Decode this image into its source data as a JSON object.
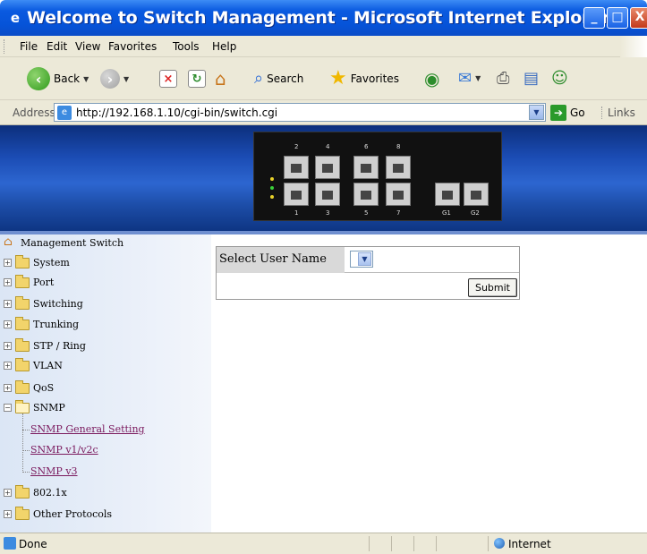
{
  "window": {
    "title": "Welcome to Switch Management - Microsoft Internet Explorer",
    "minimize": "_",
    "maximize": "□",
    "close": "X"
  },
  "menu": [
    "File",
    "Edit",
    "View",
    "Favorites",
    "Tools",
    "Help"
  ],
  "toolbar": {
    "back": "Back",
    "search": "Search",
    "favorites": "Favorites"
  },
  "address": {
    "label": "Address",
    "url": "http://192.168.1.10/cgi-bin/switch.cgi",
    "go": "Go",
    "links": "Links"
  },
  "switch_panel": {
    "top_labels": [
      "2",
      "4",
      "6",
      "8"
    ],
    "bottom_labels": [
      "1",
      "3",
      "5",
      "7",
      "G1",
      "G2"
    ]
  },
  "sidebar": {
    "root": "Management Switch",
    "items": [
      "System",
      "Port",
      "Switching",
      "Trunking",
      "STP / Ring",
      "VLAN",
      "QoS",
      "SNMP",
      "802.1x",
      "Other Protocols"
    ],
    "snmp_children": [
      "SNMP General Setting",
      "SNMP v1/v2c",
      "SNMP v3"
    ]
  },
  "form": {
    "label": "Select User Name",
    "submit": "Submit"
  },
  "status": {
    "text": "Done",
    "zone": "Internet"
  }
}
